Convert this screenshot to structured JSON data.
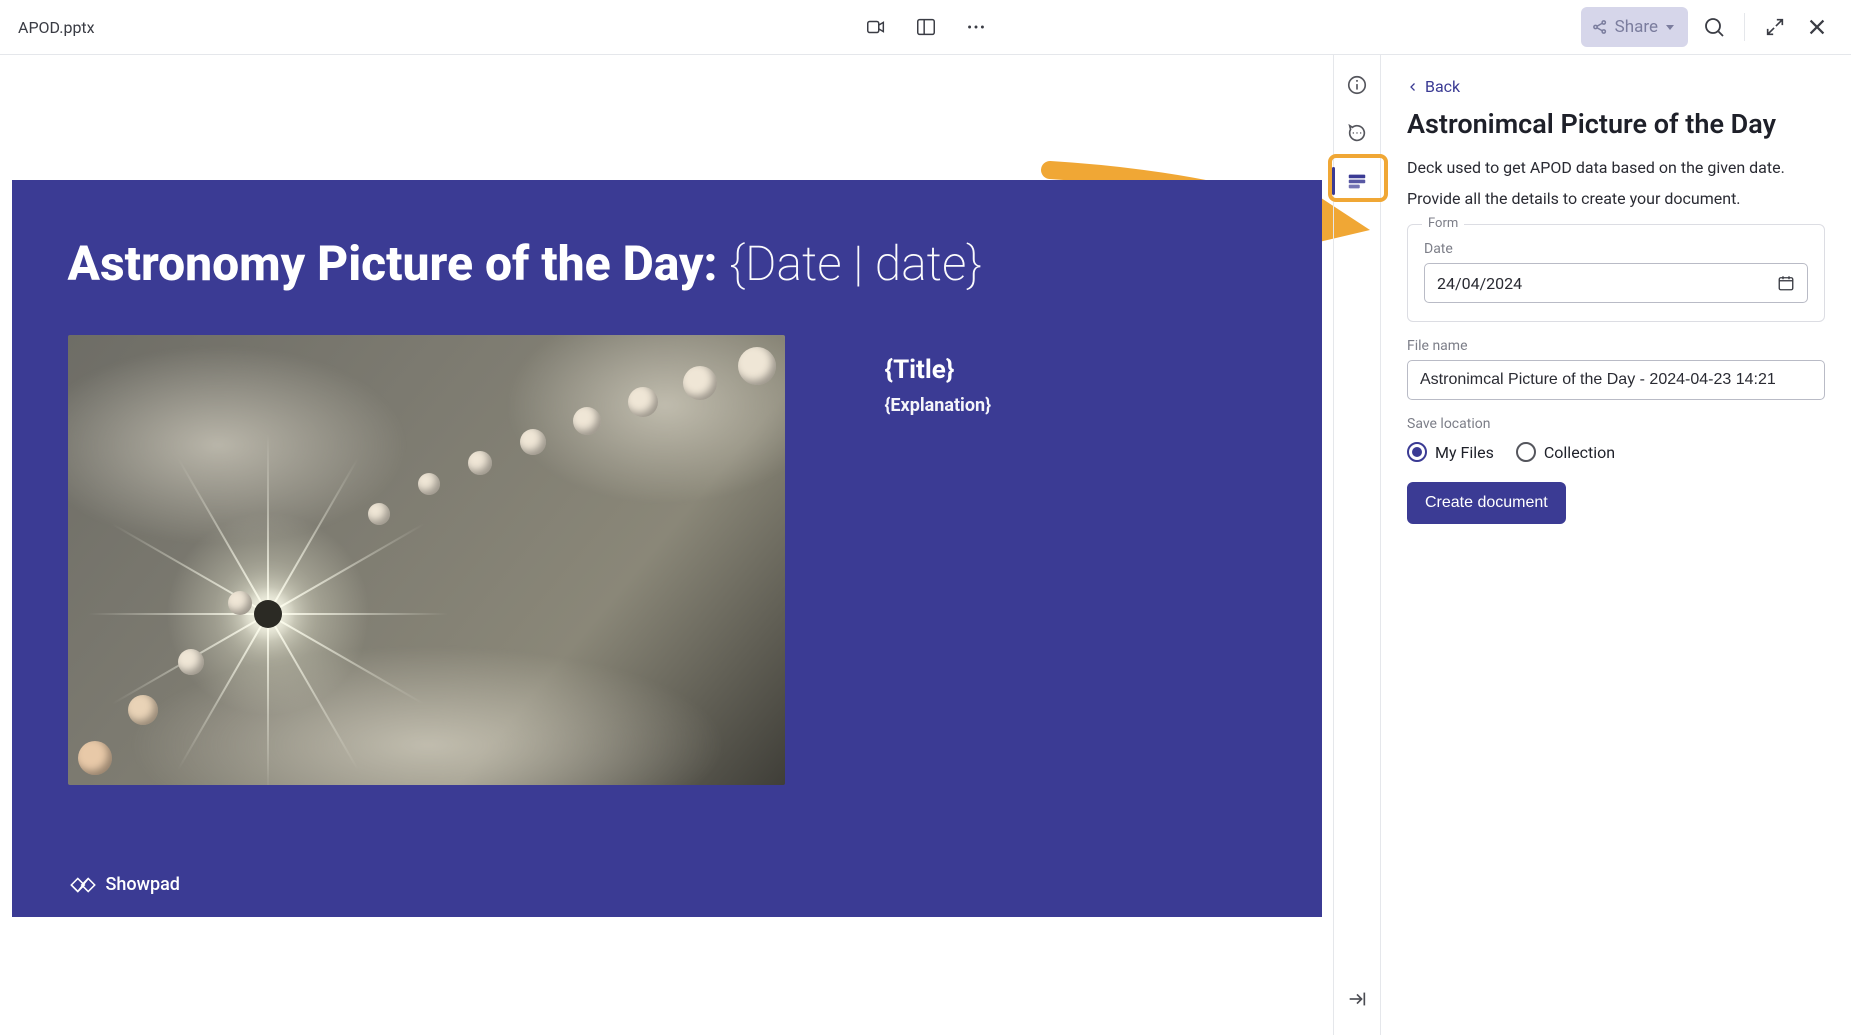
{
  "header": {
    "filename": "APOD.pptx",
    "share_label": "Share"
  },
  "slide": {
    "title_static": "Astronomy Picture of the Day: ",
    "title_placeholder": "{Date | date}",
    "title_field": "{Title}",
    "explanation_field": "{Explanation}",
    "brand": "Showpad"
  },
  "panel": {
    "back_label": "Back",
    "heading": "Astronimcal Picture of the Day",
    "description": "Deck used to get APOD data based on the given date.",
    "subtext": "Provide all the details to create your document.",
    "form_legend": "Form",
    "date_label": "Date",
    "date_value": "24/04/2024",
    "filename_label": "File name",
    "filename_value": "Astronimcal Picture of the Day - 2024-04-23 14:21",
    "save_location_label": "Save location",
    "radio_my_files": "My Files",
    "radio_collection": "Collection",
    "create_button": "Create document"
  }
}
